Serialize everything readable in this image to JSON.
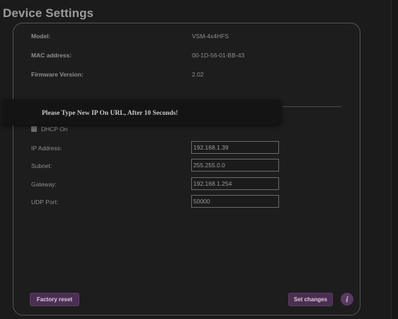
{
  "page": {
    "title": "Device Settings"
  },
  "device_info": [
    {
      "label": "Model:",
      "value": "VSM-4x4HFS"
    },
    {
      "label": "MAC address:",
      "value": "00-1D-56-01-BB-43"
    },
    {
      "label": "Firmware Version:",
      "value": "2.02"
    }
  ],
  "toast": {
    "message": "Please Type New IP On URL, After 10 Seconds!"
  },
  "network": {
    "dhcp_label": "DHCP On",
    "fields": [
      {
        "label": "IP Address:",
        "value": "192.168.1.39"
      },
      {
        "label": "Subnet:",
        "value": "255.255.0.0"
      },
      {
        "label": "Gateway:",
        "value": "192.168.1.254"
      },
      {
        "label": "UDP Port:",
        "value": "50000"
      }
    ]
  },
  "actions": {
    "factory_reset_label": "Factory reset",
    "set_changes_label": "Set changes",
    "help_icon_glyph": "i"
  },
  "colors": {
    "background": "#1b1b1b",
    "button_accent": "#4a2f52"
  },
  "icons": {
    "help": "info-icon",
    "dhcp_checkbox": "checkbox-icon"
  }
}
